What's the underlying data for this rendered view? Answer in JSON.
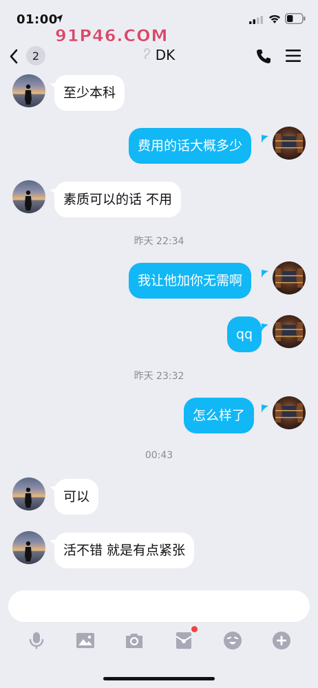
{
  "status_bar": {
    "time": "01:00",
    "battery_level": 0.4
  },
  "watermark": "91P46.COM",
  "nav": {
    "unread_count": "2",
    "title": "DK"
  },
  "messages": [
    {
      "side": "left",
      "text": "至少本科"
    },
    {
      "side": "right",
      "text": "费用的话大概多少"
    },
    {
      "side": "left",
      "text": "素质可以的话 不用"
    },
    {
      "side": "time",
      "text": "昨天 22:34"
    },
    {
      "side": "right",
      "text": "我让他加你无需啊"
    },
    {
      "side": "right",
      "text": "qq"
    },
    {
      "side": "time",
      "text": "昨天 23:32"
    },
    {
      "side": "right",
      "text": "怎么样了"
    },
    {
      "side": "time",
      "text": "00:43"
    },
    {
      "side": "left",
      "text": "可以"
    },
    {
      "side": "left",
      "text": "活不错 就是有点紧张"
    }
  ],
  "input": {
    "placeholder": ""
  },
  "toolbar": [
    "microphone-icon",
    "image-icon",
    "camera-icon",
    "red-packet-icon",
    "emoji-icon",
    "plus-icon"
  ],
  "colors": {
    "outgoing_bubble": "#12b7f5",
    "incoming_bubble": "#ffffff",
    "background": "#ececf3",
    "notification_dot": "#f0433a"
  }
}
